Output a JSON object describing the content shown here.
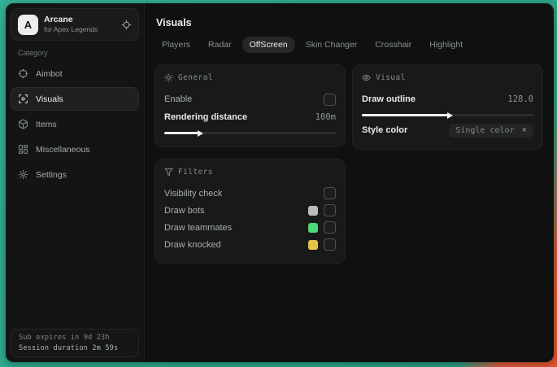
{
  "app": {
    "logo_letter": "A",
    "title": "Arcane",
    "subtitle": "for Apex Legends"
  },
  "sidebar": {
    "category_label": "Category",
    "items": [
      {
        "label": "Aimbot",
        "selected": false
      },
      {
        "label": "Visuals",
        "selected": true
      },
      {
        "label": "Items",
        "selected": false
      },
      {
        "label": "Miscellaneous",
        "selected": false
      },
      {
        "label": "Settings",
        "selected": false
      }
    ],
    "session": {
      "expires": "Sub expires in 9d 23h",
      "duration": "Session duration 2m 59s"
    }
  },
  "main": {
    "title": "Visuals",
    "tabs": [
      {
        "label": "Players",
        "selected": false
      },
      {
        "label": "Radar",
        "selected": false
      },
      {
        "label": "OffScreen",
        "selected": true
      },
      {
        "label": "Skin Changer",
        "selected": false
      },
      {
        "label": "Crosshair",
        "selected": false
      },
      {
        "label": "Highlight",
        "selected": false
      }
    ],
    "general": {
      "title": "General",
      "enable_label": "Enable",
      "enable_checked": false,
      "distance_label": "Rendering distance",
      "distance_value": "100m",
      "distance_percent": 20
    },
    "visual": {
      "title": "Visual",
      "outline_label": "Draw outline",
      "outline_value": "128.0",
      "outline_percent": 50,
      "style_label": "Style color",
      "style_chip": "Single color",
      "style_clear": "×"
    },
    "filters": {
      "title": "Filters",
      "rows": [
        {
          "label": "Visibility check",
          "swatch": null,
          "checked": false
        },
        {
          "label": "Draw bots",
          "swatch": "#b9bbbd",
          "checked": false
        },
        {
          "label": "Draw teammates",
          "swatch": "#4bd97a",
          "checked": false
        },
        {
          "label": "Draw knocked",
          "swatch": "#e3c348",
          "checked": false
        }
      ]
    }
  },
  "colors": {
    "desktop_teal": "#2ba487",
    "desktop_orange": "#d8573a",
    "slider_fill": "#f2f3f2",
    "card_bg": "#181a19",
    "window_bg": "#0f1110"
  }
}
